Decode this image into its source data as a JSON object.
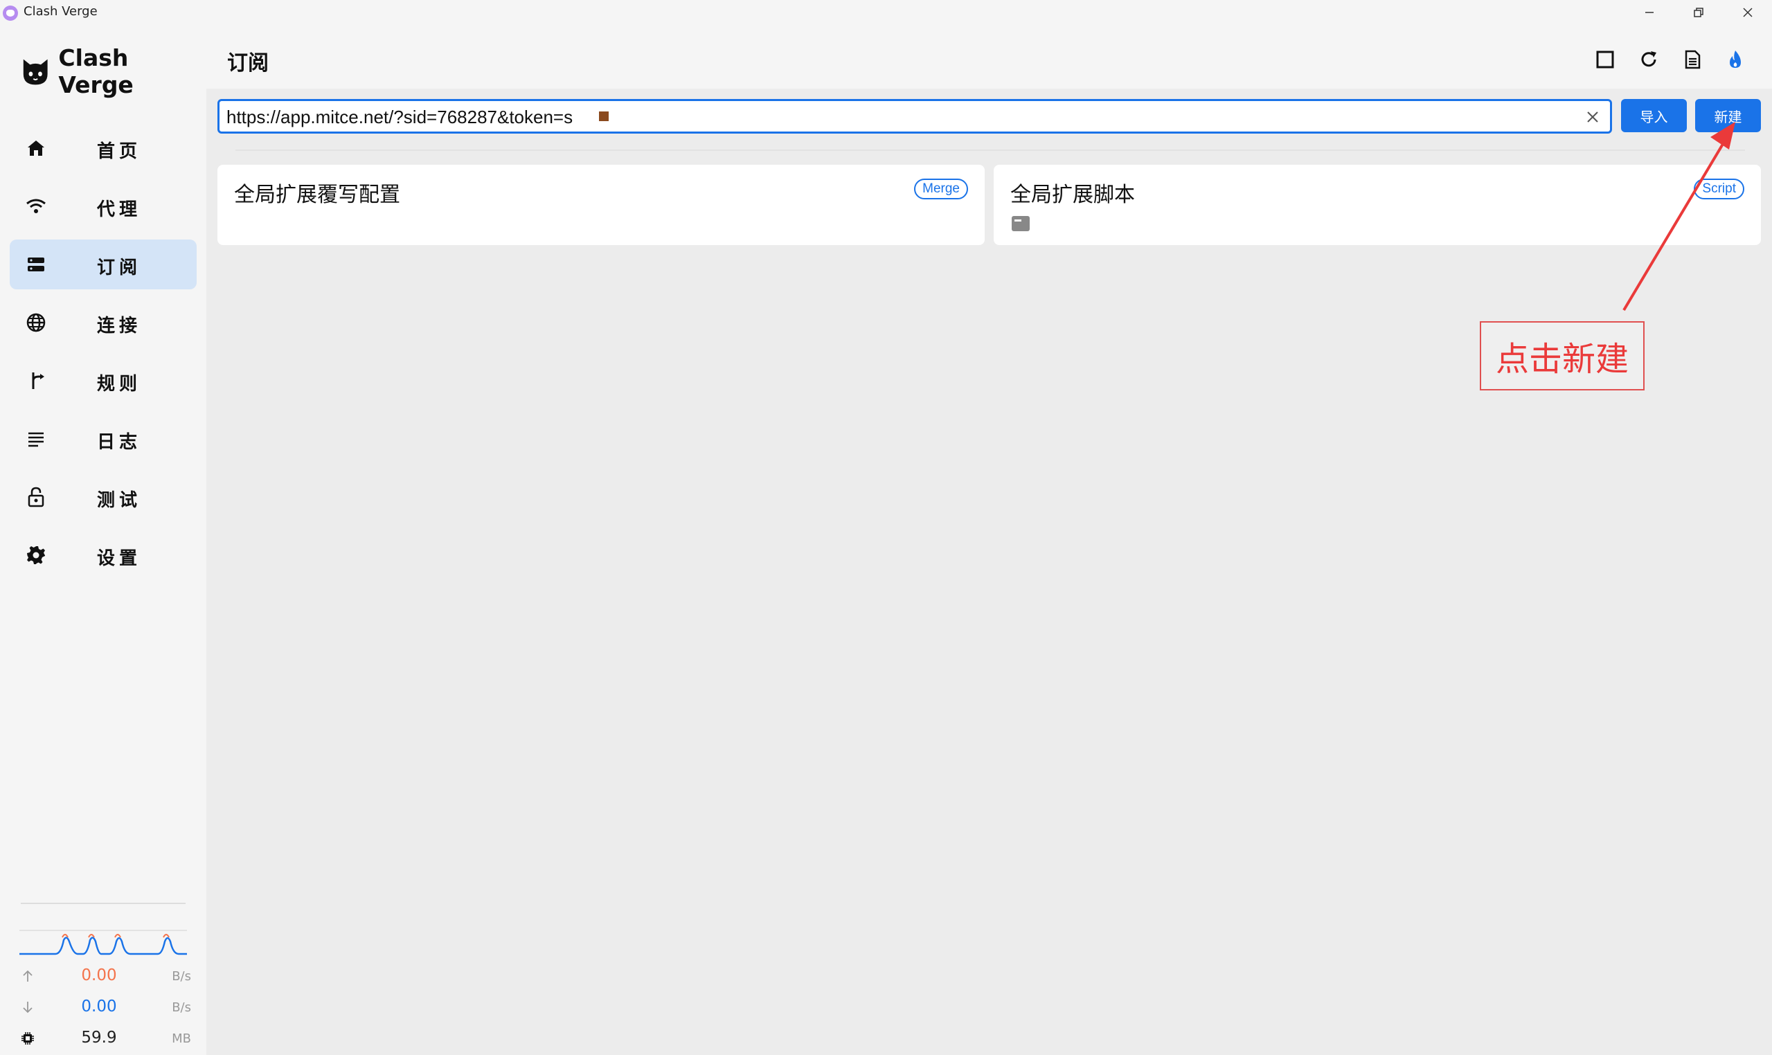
{
  "window": {
    "title": "Clash Verge"
  },
  "sidebar": {
    "app_name": "Clash Verge",
    "items": [
      {
        "label": "首页",
        "icon": "home-icon"
      },
      {
        "label": "代理",
        "icon": "wifi-icon"
      },
      {
        "label": "订阅",
        "icon": "server-icon",
        "active": true
      },
      {
        "label": "连接",
        "icon": "globe-icon"
      },
      {
        "label": "规则",
        "icon": "fork-icon"
      },
      {
        "label": "日志",
        "icon": "list-icon"
      },
      {
        "label": "测试",
        "icon": "lock-icon"
      },
      {
        "label": "设置",
        "icon": "gear-icon"
      }
    ],
    "stats": {
      "upload": {
        "value": "0.00",
        "unit": "B/s",
        "color": "#f4744c"
      },
      "download": {
        "value": "0.00",
        "unit": "B/s",
        "color": "#1a73e8"
      },
      "memory": {
        "value": "59.9",
        "unit": "MB",
        "color": "#222222"
      }
    }
  },
  "header": {
    "title": "订阅",
    "icons": [
      "square-icon",
      "refresh-icon",
      "document-icon",
      "fire-icon"
    ]
  },
  "import_bar": {
    "url_value": "https://app.mitce.net/?sid=768287&token=s",
    "import_label": "导入",
    "new_label": "新建"
  },
  "cards": [
    {
      "title": "全局扩展覆写配置",
      "badge": "Merge"
    },
    {
      "title": "全局扩展脚本",
      "badge": "Script"
    }
  ],
  "annotation": {
    "text": "点击新建",
    "color": "#ea3a3a"
  },
  "colors": {
    "accent": "#1a73e8",
    "active_nav_bg": "#d4e4f7"
  }
}
